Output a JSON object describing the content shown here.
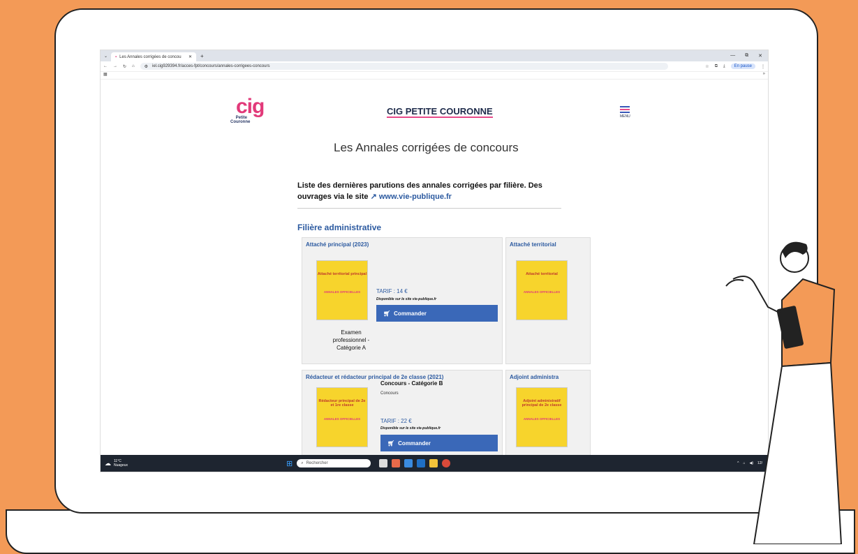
{
  "browser": {
    "tab_title": "Les Annales corrigées de concou",
    "tab_close": "✕",
    "new_tab": "+",
    "url": "iel.cig929394.fr/acces-fpt/concours/annales-corrigees-concours",
    "pause_label": "En pause",
    "win_min": "—",
    "win_max": "⧉",
    "win_close": "✕"
  },
  "site": {
    "logo_text": "cig",
    "logo_sub": "Petite Couronne",
    "title": "CIG PETITE COURONNE",
    "menu_label": "MENU"
  },
  "page": {
    "heading": "Les Annales corrigées de concours",
    "intro": "Liste des dernières parutions des annales corrigées par filière. Des ouvrages via le site",
    "intro_link": "www.vie-publique.fr",
    "filiere": "Filière administrative"
  },
  "cards": [
    {
      "title": "Attaché principal (2023)",
      "cover_title": "Attaché territorial principal",
      "cover_sub": "ANNALES OFFICIELLES",
      "tarif": "TARIF : 14 €",
      "dispo": "Disponible sur le site vie-publique.fr",
      "button": "Commander",
      "caption": "Examen professionnel - Catégorie A"
    },
    {
      "title": "Attaché territorial",
      "cover_title": "Attaché territorial",
      "cover_sub": "ANNALES OFFICIELLES"
    },
    {
      "title": "Rédacteur et rédacteur principal de 2e classe (2021)",
      "subtitle": "Concours - Catégorie B",
      "type": "Concours",
      "cover_title": "Rédacteur principal de 2e et 1re classe",
      "cover_sub": "ANNALES OFFICIELLES",
      "tarif": "TARIF : 22 €",
      "dispo": "Disponible sur le site vie-publique.fr",
      "button": "Commander"
    },
    {
      "title": "Adjoint administra",
      "cover_title": "Adjoint administratif principal de 2e classe",
      "cover_sub": "ANNALES OFFICIELLES"
    }
  ],
  "taskbar": {
    "weather_temp": "11°C",
    "weather_desc": "Nuageux",
    "search_placeholder": "Rechercher",
    "clock": "12/"
  },
  "colors": {
    "background": "#f39a57",
    "accent_blue": "#3a68b8",
    "accent_pink": "#e84a8a",
    "cover_yellow": "#f7d42c"
  }
}
